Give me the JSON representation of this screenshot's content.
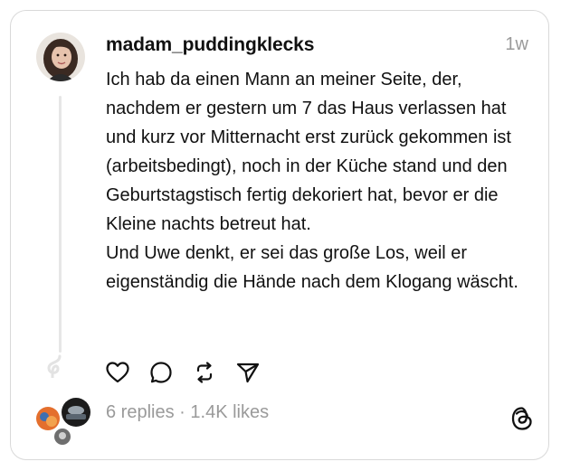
{
  "post": {
    "username": "madam_puddingklecks",
    "timestamp": "1w",
    "paragraphs": [
      "Ich hab da einen Mann an meiner Seite, der, nachdem er gestern um 7 das Haus verlassen hat und kurz vor Mitternacht erst zurück gekommen ist (arbeitsbedingt), noch in der Küche stand und den Geburtstagstisch fertig dekoriert hat, bevor er die Kleine nachts betreut hat.",
      "Und Uwe denkt, er sei das große Los, weil er eigenständig die Hände nach dem Klogang wäscht."
    ]
  },
  "actions": {
    "like": "heart-icon",
    "reply": "comment-icon",
    "repost": "repost-icon",
    "share": "send-icon"
  },
  "stats": {
    "replies": "6 replies",
    "separator": "·",
    "likes": "1.4K likes"
  },
  "colors": {
    "text": "#111111",
    "muted": "#9a9a9a",
    "border": "#d9d9d9"
  }
}
